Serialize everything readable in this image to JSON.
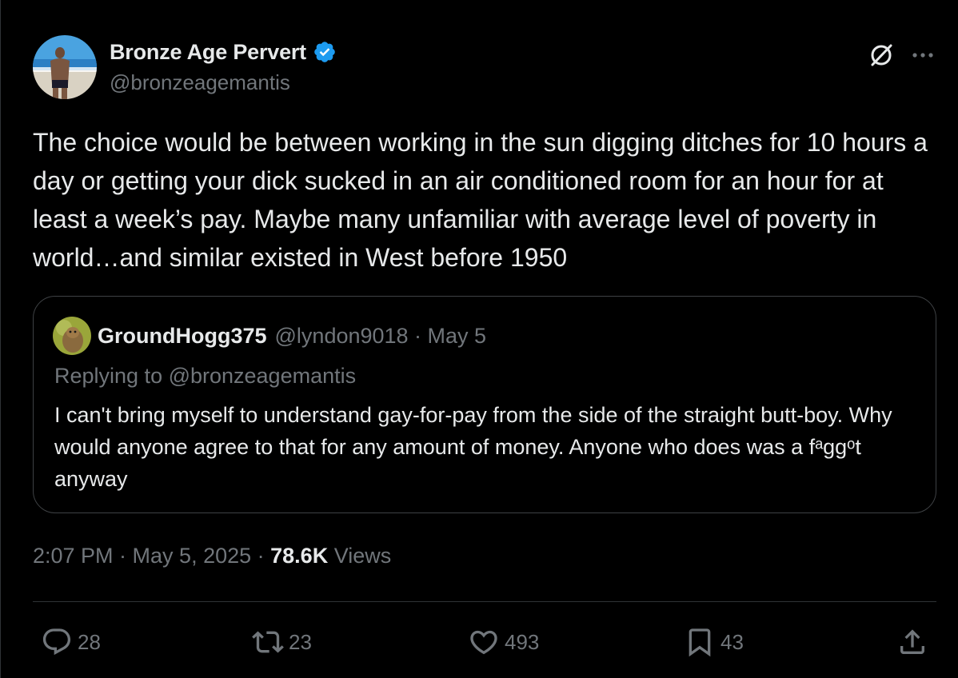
{
  "tweet": {
    "author": {
      "display_name": "Bronze Age Pervert",
      "handle": "@bronzeagemantis",
      "verified": true
    },
    "text": "The choice would be between working in the sun digging ditches for 10 hours a day or getting your dick sucked in an air conditioned room for an hour for at least a week’s pay. Maybe many unfamiliar with average level of poverty in world…and similar existed in West before 1950",
    "quote": {
      "display_name": "GroundHogg375",
      "handle_date": "@lyndon9018 · May 5",
      "replying_to": "Replying to @bronzeagemantis",
      "text": "I can't bring myself to understand gay-for-pay from the side of the straight butt-boy. Why would anyone agree to that for any amount of money. Anyone who does was a fᵃggᵒt anyway"
    },
    "meta": {
      "timestamp": "2:07 PM · May 5, 2025 · ",
      "views_count": "78.6K",
      "views_label": " Views"
    },
    "actions": {
      "replies": "28",
      "retweets": "23",
      "likes": "493",
      "bookmarks": "43"
    }
  },
  "icons": {
    "verified": "verified-badge-icon",
    "grok": "grok-icon",
    "more": "more-icon",
    "reply": "reply-icon",
    "retweet": "retweet-icon",
    "like": "heart-icon",
    "bookmark": "bookmark-icon",
    "share": "share-icon"
  },
  "colors": {
    "background": "#000000",
    "text_primary": "#e7e9ea",
    "text_secondary": "#71767b",
    "verified_blue": "#1d9bf0",
    "border": "#2f3336"
  }
}
